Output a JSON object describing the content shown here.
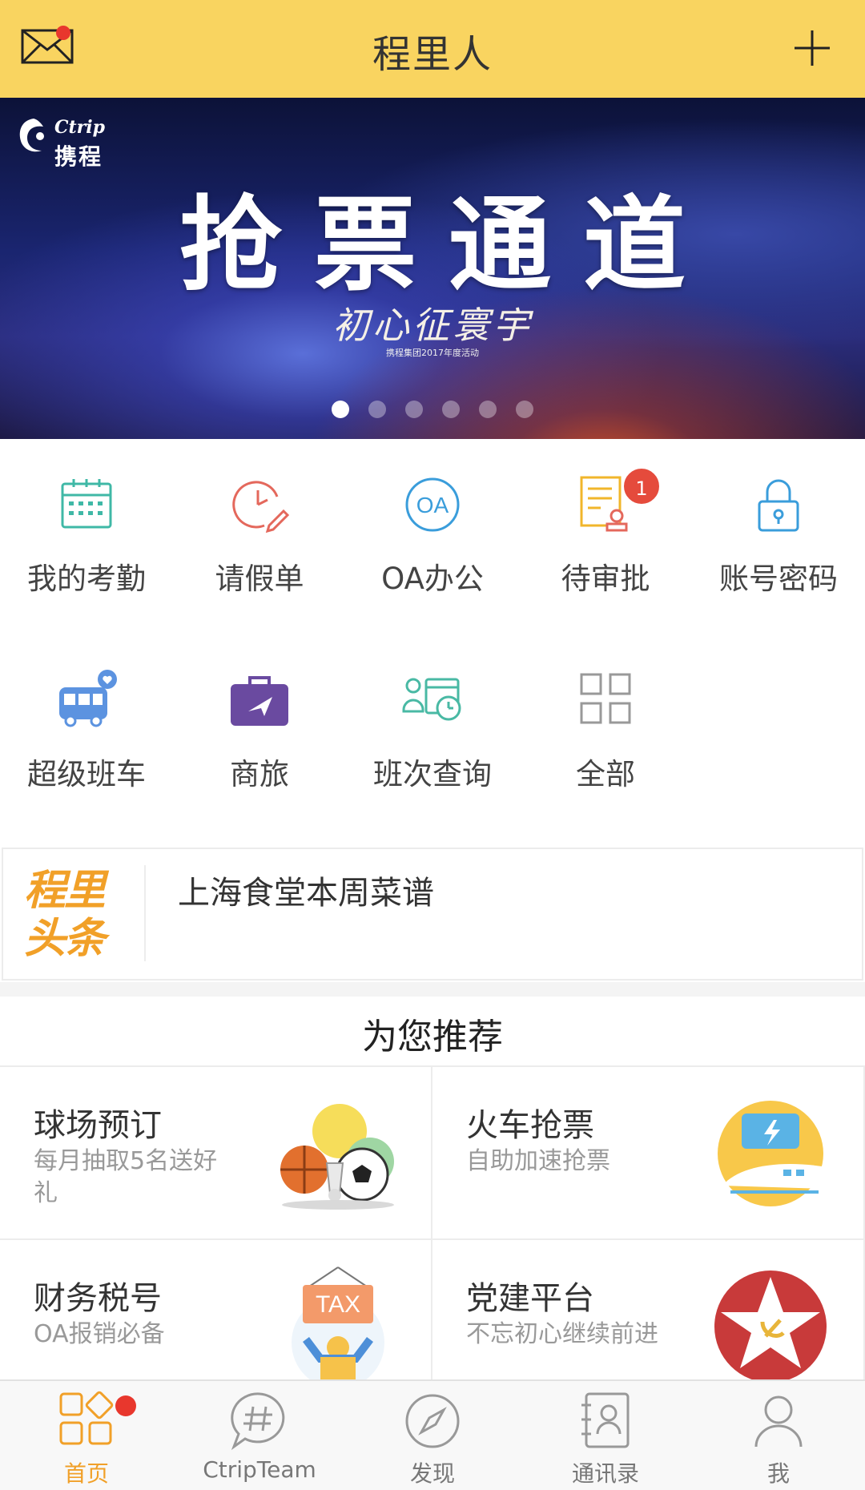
{
  "header": {
    "title": "程里人"
  },
  "banner": {
    "logo_en": "Ctrip",
    "logo_cn": "携程",
    "headline": "抢票通道",
    "slogan": "初心征寰宇",
    "slogan_sub": "携程集团2017年度活动",
    "page_count": 6,
    "active_page": 1
  },
  "grid": [
    {
      "label": "我的考勤",
      "icon": "calendar-icon"
    },
    {
      "label": "请假单",
      "icon": "clock-pen-icon"
    },
    {
      "label": "OA办公",
      "icon": "oa-icon",
      "icon_text": "OA"
    },
    {
      "label": "待审批",
      "icon": "document-stamp-icon",
      "badge": "1"
    },
    {
      "label": "账号密码",
      "icon": "lock-icon"
    },
    {
      "label": "超级班车",
      "icon": "bus-icon"
    },
    {
      "label": "商旅",
      "icon": "briefcase-plane-icon"
    },
    {
      "label": "班次查询",
      "icon": "schedule-query-icon"
    },
    {
      "label": "全部",
      "icon": "grid-all-icon"
    }
  ],
  "news": {
    "tag_line1": "程里",
    "tag_line2": "头条",
    "text": "上海食堂本周菜谱"
  },
  "recommend": {
    "title": "为您推荐",
    "items": [
      {
        "title": "球场预订",
        "subtitle": "每月抽取5名送好礼",
        "icon": "sports-balls-icon"
      },
      {
        "title": "火车抢票",
        "subtitle": "自助加速抢票",
        "icon": "train-ticket-icon"
      },
      {
        "title": "财务税号",
        "subtitle": "OA报销必备",
        "icon": "tax-sign-icon",
        "icon_text": "TAX"
      },
      {
        "title": "党建平台",
        "subtitle": "不忘初心继续前进",
        "icon": "party-star-icon"
      }
    ]
  },
  "tabbar": [
    {
      "label": "首页",
      "icon": "home-grid-icon",
      "active": true
    },
    {
      "label": "CtripTeam",
      "icon": "hashtag-chat-icon"
    },
    {
      "label": "发现",
      "icon": "compass-icon"
    },
    {
      "label": "通讯录",
      "icon": "contacts-icon"
    },
    {
      "label": "我",
      "icon": "person-icon"
    }
  ],
  "colors": {
    "header": "#f9d460",
    "accent": "#f1a028",
    "badge": "#e54b3c"
  }
}
